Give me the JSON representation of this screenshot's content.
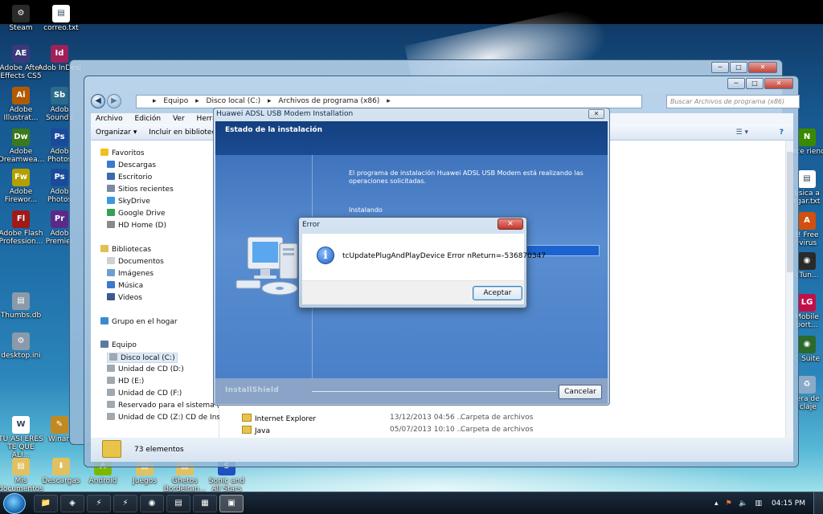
{
  "desktop": {
    "icons_left": [
      {
        "label": "Steam",
        "glyph": "⚙",
        "color": "#2a2a2a"
      },
      {
        "label": "Adobe After Effects CS5",
        "glyph": "AE",
        "color": "#3a3a7a"
      },
      {
        "label": "Adobe Illustrat...",
        "glyph": "Ai",
        "color": "#b35a00"
      },
      {
        "label": "Adobe Dreamwea...",
        "glyph": "Dw",
        "color": "#3a7a1a"
      },
      {
        "label": "Adobe Firewor...",
        "glyph": "Fw",
        "color": "#b3a000"
      },
      {
        "label": "Adobe Flash Profession...",
        "glyph": "Fl",
        "color": "#a01a1a"
      },
      {
        "label": "Thumbs.db",
        "glyph": "▤",
        "color": "#8a9aaa"
      },
      {
        "label": "desktop.ini",
        "glyph": "⚙",
        "color": "#8a9aaa"
      },
      {
        "label": "TU ASI ERES TE QUE ALI...",
        "glyph": "W",
        "color": "#ffffff"
      },
      {
        "label": "Mis documentos",
        "glyph": "▤",
        "color": "#e0c060"
      }
    ],
    "icons_second": [
      {
        "label": "correo.txt",
        "glyph": "▤",
        "color": "#ffffff"
      },
      {
        "label": "Adob InDesi",
        "glyph": "Id",
        "color": "#a0205a"
      },
      {
        "label": "Adob Soundb",
        "glyph": "Sb",
        "color": "#2a6a8a"
      },
      {
        "label": "Adob Photos",
        "glyph": "Ps",
        "color": "#1a4a9a"
      },
      {
        "label": "Adob Photos",
        "glyph": "Ps",
        "color": "#1a4a9a"
      },
      {
        "label": "Adob Premier",
        "glyph": "Pr",
        "color": "#5a2a8a"
      },
      {
        "label": "Winan",
        "glyph": "✎",
        "color": "#c08a20"
      },
      {
        "label": "Descargas",
        "glyph": "⬇",
        "color": "#e0c060"
      }
    ],
    "icons_bottom": [
      {
        "label": "Android",
        "glyph": "A",
        "color": "#7ab800"
      },
      {
        "label": "Juegos",
        "glyph": "▤",
        "color": "#e0c060"
      },
      {
        "label": "Ghetos Bordelran...",
        "glyph": "▤",
        "color": "#e0c060"
      },
      {
        "label": "Sonic and All Stars Ra...",
        "glyph": "S",
        "color": "#2050c0"
      }
    ],
    "icons_right": [
      {
        "label": "Force rience",
        "glyph": "N",
        "color": "#3a8a00"
      },
      {
        "label": "úsica a rgar.txt",
        "glyph": "▤",
        "color": "#ffffff"
      },
      {
        "label": "t! Free ivirus",
        "glyph": "A",
        "color": "#d05010"
      },
      {
        "label": "cTun...",
        "glyph": "◉",
        "color": "#2a2a2a"
      },
      {
        "label": "Mobile port...",
        "glyph": "LG",
        "color": "#c0104a"
      },
      {
        "label": "C Suite",
        "glyph": "◉",
        "color": "#2a6a2a"
      },
      {
        "label": "lera de iclaje",
        "glyph": "♻",
        "color": "#8aaac8"
      }
    ]
  },
  "explorer": {
    "address": [
      "Equipo",
      "Disco local (C:)",
      "Archivos de programa (x86)"
    ],
    "search_placeholder": "Buscar Archivos de programa (x86)",
    "menu": [
      "Archivo",
      "Edición",
      "Ver",
      "Herramie"
    ],
    "toolbar": {
      "organize": "Organizar ▾",
      "include": "Incluir en biblioteca"
    },
    "nav": {
      "favorites": "Favoritos",
      "fav_items": [
        "Descargas",
        "Escritorio",
        "Sitios recientes",
        "SkyDrive",
        "Google Drive",
        "HD Home (D)"
      ],
      "libraries": "Bibliotecas",
      "lib_items": [
        "Documentos",
        "Imágenes",
        "Música",
        "Videos"
      ],
      "homegroup": "Grupo en el hogar",
      "computer": "Equipo",
      "drives": [
        "Disco local (C:)",
        "Unidad de CD (D:)",
        "HD (E:)",
        "Unidad de CD (F:)",
        "Reservado para el sistema (Y:)",
        "Unidad de CD (Z:) CD de Instalación"
      ]
    },
    "files": [
      {
        "name": "Internet Explorer",
        "date": "13/12/2013 04:56 ...",
        "type": "Carpeta de archivos"
      },
      {
        "name": "Java",
        "date": "05/07/2013 10:10 ...",
        "type": "Carpeta de archivos"
      }
    ],
    "status": "73 elementos"
  },
  "installer": {
    "title": "Huawei ADSL USB Modem Installation",
    "header": "Estado de la instalación",
    "message": "El programa de instalación Huawei ADSL USB Modem está realizando las operaciones solicitadas.",
    "status": "Instalando",
    "progress": 0.12,
    "brand": "InstallShield",
    "cancel": "Cancelar"
  },
  "error": {
    "title": "Error",
    "message": "tcUpdatePlugAndPlayDevice Error nReturn=-536870347",
    "ok": "Aceptar",
    "close": "✕"
  },
  "taskbar": {
    "clock": "04:15 PM",
    "items": [
      "📁",
      "◈",
      "⚡",
      "⚡",
      "◉",
      "▤",
      "▦",
      "▣"
    ]
  }
}
